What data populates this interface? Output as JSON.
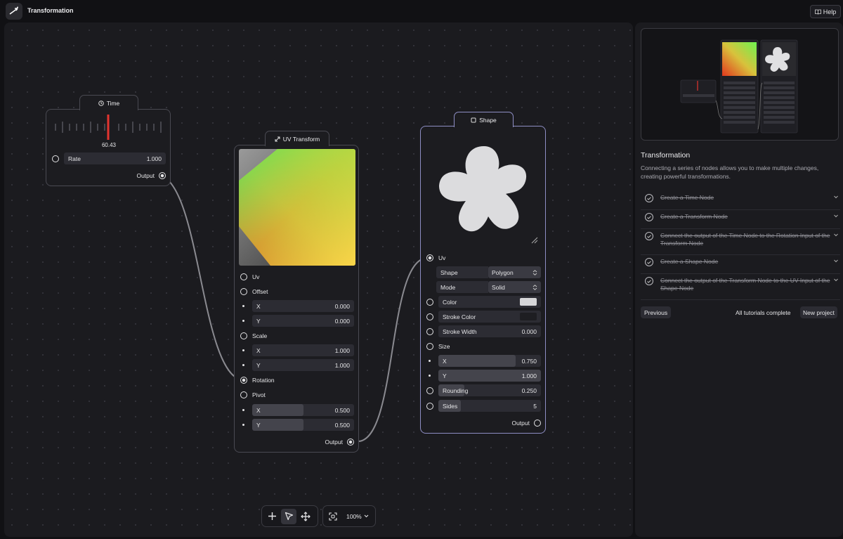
{
  "app": {
    "title": "Transformation",
    "help_label": "Help"
  },
  "time_node": {
    "title": "Time",
    "value_readout": "60.43",
    "rate_label": "Rate",
    "rate_value": "1.000",
    "output_label": "Output"
  },
  "uv_node": {
    "title": "UV Transform",
    "uv_label": "Uv",
    "offset_label": "Offset",
    "offset_x_label": "X",
    "offset_x": "0.000",
    "offset_y_label": "Y",
    "offset_y": "0.000",
    "scale_label": "Scale",
    "scale_x_label": "X",
    "scale_x": "1.000",
    "scale_y_label": "Y",
    "scale_y": "1.000",
    "rotation_label": "Rotation",
    "pivot_label": "Pivot",
    "pivot_x_label": "X",
    "pivot_x": "0.500",
    "pivot_y_label": "Y",
    "pivot_y": "0.500",
    "output_label": "Output"
  },
  "shape_node": {
    "title": "Shape",
    "uv_label": "Uv",
    "shape_label": "Shape",
    "shape_value": "Polygon",
    "mode_label": "Mode",
    "mode_value": "Solid",
    "color_label": "Color",
    "color_value": "#d6d6d8",
    "stroke_color_label": "Stroke Color",
    "stroke_color_value": "#1e1e22",
    "stroke_width_label": "Stroke Width",
    "stroke_width": "0.000",
    "size_label": "Size",
    "size_x_label": "X",
    "size_x": "0.750",
    "size_y_label": "Y",
    "size_y": "1.000",
    "rounding_label": "Rounding",
    "rounding": "0.250",
    "sides_label": "Sides",
    "sides": "5",
    "output_label": "Output"
  },
  "toolbar": {
    "zoom": "100%"
  },
  "tutorial": {
    "title": "Transformation",
    "description": "Connecting a series of nodes allows you to make multiple changes, creating powerful transformations.",
    "steps": [
      {
        "label": "Create a Time Node"
      },
      {
        "label": "Create a Transform Node"
      },
      {
        "label": "Connect the output of the Time Node to the Rotation Input of the Transform Node"
      },
      {
        "label": "Create a Shape Node"
      },
      {
        "label": "Connect the output of the Transform Node to the UV Input of the Shape Node"
      }
    ],
    "previous_label": "Previous",
    "status": "All tutorials complete",
    "new_project_label": "New project"
  },
  "colors": {
    "accent_red": "#e3342f",
    "selected_border": "#8e8ec4",
    "background": "#1b1b1f"
  }
}
